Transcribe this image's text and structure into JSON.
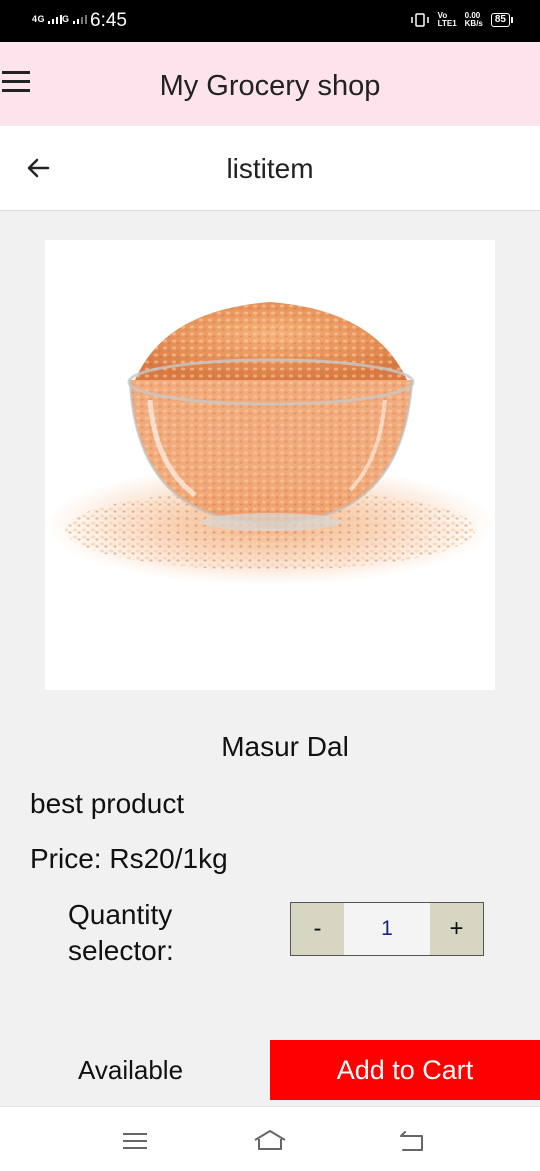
{
  "status_bar": {
    "network1": "4G",
    "network2": "G",
    "time": "6:45",
    "volte": "Vo",
    "lte": "LTE1",
    "speed": "0.00",
    "speed_unit": "KB/s",
    "battery": "85"
  },
  "app_bar": {
    "title": "My Grocery shop",
    "menu_icon": "hamburger-menu-icon"
  },
  "sub_header": {
    "title": "listitem",
    "back_icon": "arrow-left-icon"
  },
  "product": {
    "name": "Masur Dal",
    "description": "best product",
    "price": "Price: Rs20/1kg",
    "image": "masur-dal-bowl"
  },
  "quantity": {
    "label": "Quantity selector:",
    "minus": "-",
    "value": "1",
    "plus": "+"
  },
  "availability": "Available",
  "cart_button": "Add to Cart",
  "nav_bar": {
    "items": [
      "recent-apps-icon",
      "home-icon",
      "back-icon"
    ]
  },
  "colors": {
    "app_bar_bg": "#fde4ec",
    "cart_button_bg": "#ff0000",
    "stepper_button_bg": "#d6d6c2"
  }
}
